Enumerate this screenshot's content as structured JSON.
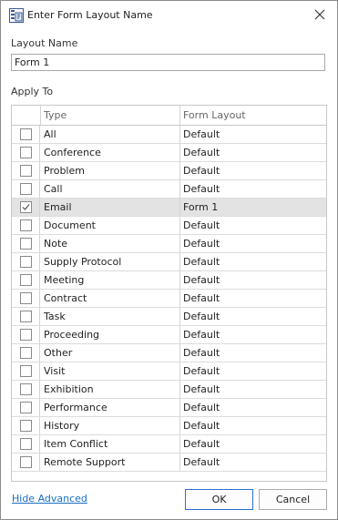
{
  "window": {
    "title": "Enter Form Layout Name",
    "close_icon": "close-icon",
    "app_icon": "form-layout-icon"
  },
  "layout_name": {
    "label": "Layout Name",
    "value": "Form 1"
  },
  "apply_to": {
    "label": "Apply To",
    "columns": {
      "type": "Type",
      "form_layout": "Form Layout"
    },
    "rows": [
      {
        "type": "All",
        "form_layout": "Default",
        "checked": false
      },
      {
        "type": "Conference",
        "form_layout": "Default",
        "checked": false
      },
      {
        "type": "Problem",
        "form_layout": "Default",
        "checked": false
      },
      {
        "type": "Call",
        "form_layout": "Default",
        "checked": false
      },
      {
        "type": "Email",
        "form_layout": "Form 1",
        "checked": true
      },
      {
        "type": "Document",
        "form_layout": "Default",
        "checked": false
      },
      {
        "type": "Note",
        "form_layout": "Default",
        "checked": false
      },
      {
        "type": "Supply Protocol",
        "form_layout": "Default",
        "checked": false
      },
      {
        "type": "Meeting",
        "form_layout": "Default",
        "checked": false
      },
      {
        "type": "Contract",
        "form_layout": "Default",
        "checked": false
      },
      {
        "type": "Task",
        "form_layout": "Default",
        "checked": false
      },
      {
        "type": "Proceeding",
        "form_layout": "Default",
        "checked": false
      },
      {
        "type": "Other",
        "form_layout": "Default",
        "checked": false
      },
      {
        "type": "Visit",
        "form_layout": "Default",
        "checked": false
      },
      {
        "type": "Exhibition",
        "form_layout": "Default",
        "checked": false
      },
      {
        "type": "Performance",
        "form_layout": "Default",
        "checked": false
      },
      {
        "type": "History",
        "form_layout": "Default",
        "checked": false
      },
      {
        "type": "Item Conflict",
        "form_layout": "Default",
        "checked": false
      },
      {
        "type": "Remote Support",
        "form_layout": "Default",
        "checked": false
      }
    ]
  },
  "footer": {
    "hide_advanced": "Hide Advanced",
    "ok": "OK",
    "cancel": "Cancel"
  },
  "colors": {
    "accent": "#2b6fd6",
    "link": "#1a6fc4",
    "selected_row": "#e3e3e3"
  }
}
